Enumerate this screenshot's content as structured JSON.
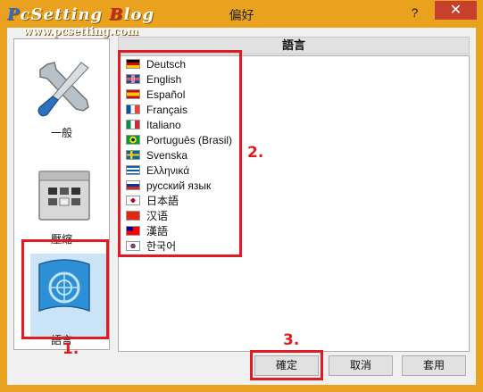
{
  "watermark": {
    "brand_p": "P",
    "brand_rest": "cSetting ",
    "brand_s": "B",
    "brand_tail": "log",
    "site": "www.pcsetting.com"
  },
  "window": {
    "title": "偏好",
    "help": "?",
    "close": "✕"
  },
  "nav": {
    "items": [
      {
        "label": "一般",
        "icon": "wrench-screwdriver-icon"
      },
      {
        "label": "壓縮",
        "icon": "archive-icon"
      },
      {
        "label": "語言",
        "icon": "globe-map-icon",
        "selected": true
      }
    ]
  },
  "section": {
    "title": "語言"
  },
  "languages": [
    {
      "name": "Deutsch",
      "flag": "de"
    },
    {
      "name": "English",
      "flag": "gb"
    },
    {
      "name": "Español",
      "flag": "es"
    },
    {
      "name": "Français",
      "flag": "fr"
    },
    {
      "name": "Italiano",
      "flag": "it"
    },
    {
      "name": "Português (Brasil)",
      "flag": "br"
    },
    {
      "name": "Svenska",
      "flag": "se"
    },
    {
      "name": "Ελληνικά",
      "flag": "gr"
    },
    {
      "name": "русский язык",
      "flag": "ru"
    },
    {
      "name": "日本語",
      "flag": "jp"
    },
    {
      "name": "汉语",
      "flag": "cn"
    },
    {
      "name": "漢語",
      "flag": "tw"
    },
    {
      "name": "한국어",
      "flag": "kr"
    }
  ],
  "buttons": {
    "ok": "確定",
    "cancel": "取消",
    "apply": "套用"
  },
  "annotations": {
    "one": "1.",
    "two": "2.",
    "three": "3."
  },
  "colors": {
    "highlight": "#e01b22",
    "selection": "#cce4f7",
    "titlebar": "#e9a11e",
    "close": "#c7402c"
  }
}
